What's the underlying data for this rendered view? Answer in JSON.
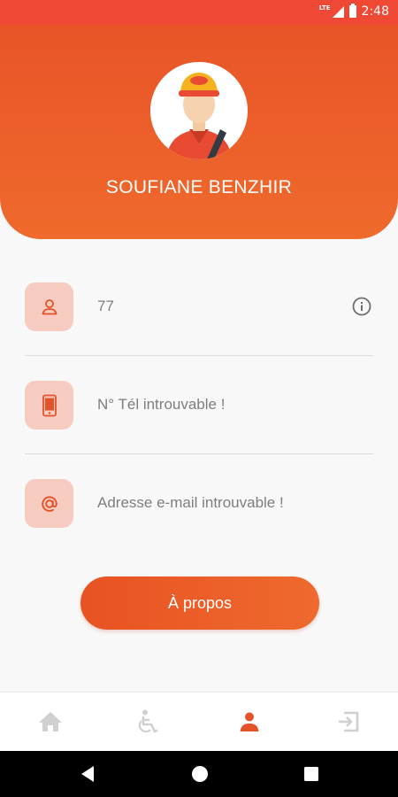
{
  "status_bar": {
    "network": "LTE",
    "time": "2:48"
  },
  "profile": {
    "name": "SOUFIANE BENZHIR"
  },
  "info": {
    "id_value": "77",
    "phone_value": "N° Tél introuvable !",
    "email_value": "Adresse e-mail introuvable !"
  },
  "about_button": {
    "label": "À propos"
  },
  "nav": {
    "items": [
      {
        "icon": "home-icon",
        "active": false
      },
      {
        "icon": "wheelchair-icon",
        "active": false
      },
      {
        "icon": "person-icon",
        "active": true
      },
      {
        "icon": "logout-icon",
        "active": false
      }
    ]
  },
  "colors": {
    "accent": "#ea5a26",
    "icon_box_bg": "#f6cbc0",
    "inactive_nav_icon": "#d0d0d0"
  }
}
